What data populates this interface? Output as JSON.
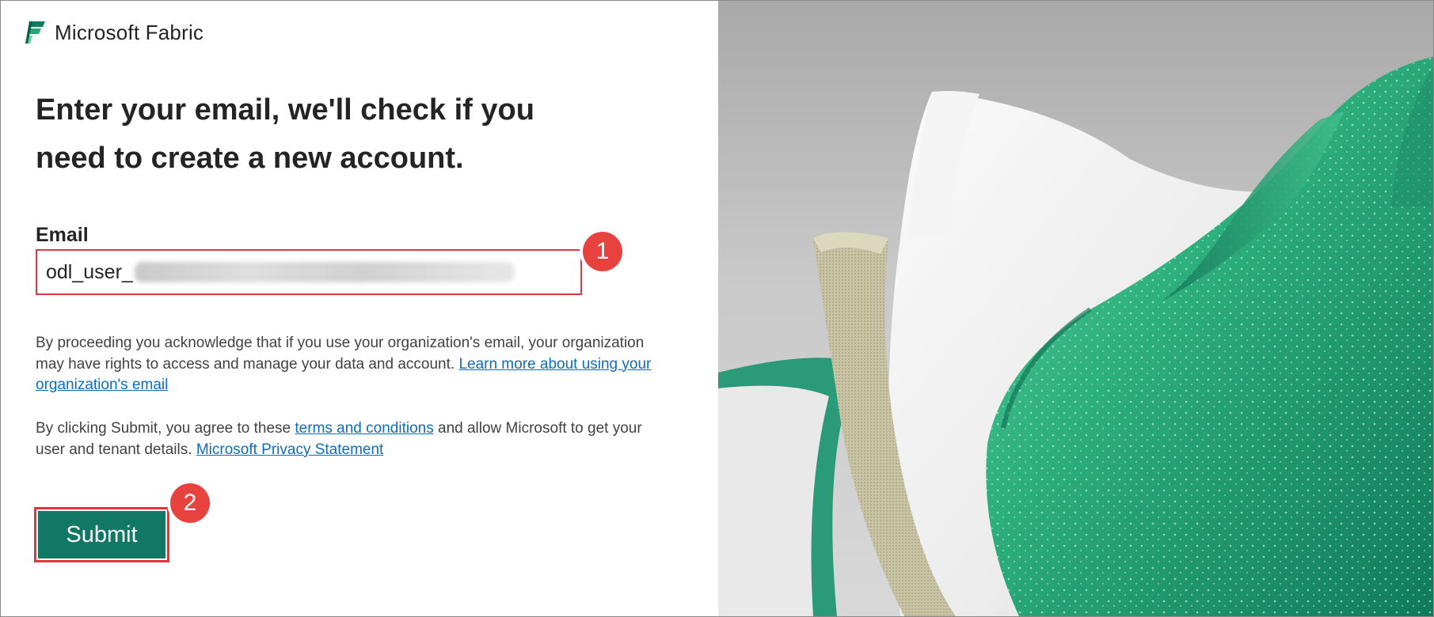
{
  "brand": {
    "name": "Microsoft Fabric",
    "logo_icon": "fabric-logo-icon"
  },
  "headline": "Enter your email, we'll check if you need to create a new account.",
  "email": {
    "label": "Email",
    "value": "odl_user_"
  },
  "annotations": {
    "step1": "1",
    "step2": "2"
  },
  "notice1": {
    "text": "By proceeding you acknowledge that if you use your organization's email, your organization may have rights to access and manage your data and account. ",
    "link": "Learn more about using your organization's email"
  },
  "notice2": {
    "text_before": "By clicking Submit, you agree to these ",
    "terms_link": "terms and conditions",
    "text_middle": " and allow Microsoft to get your user and tenant details. ",
    "privacy_link": "Microsoft Privacy Statement"
  },
  "submit": {
    "label": "Submit"
  },
  "colors": {
    "accent": "#117865",
    "annotation": "#e8423f",
    "link": "#0f6cbd"
  }
}
